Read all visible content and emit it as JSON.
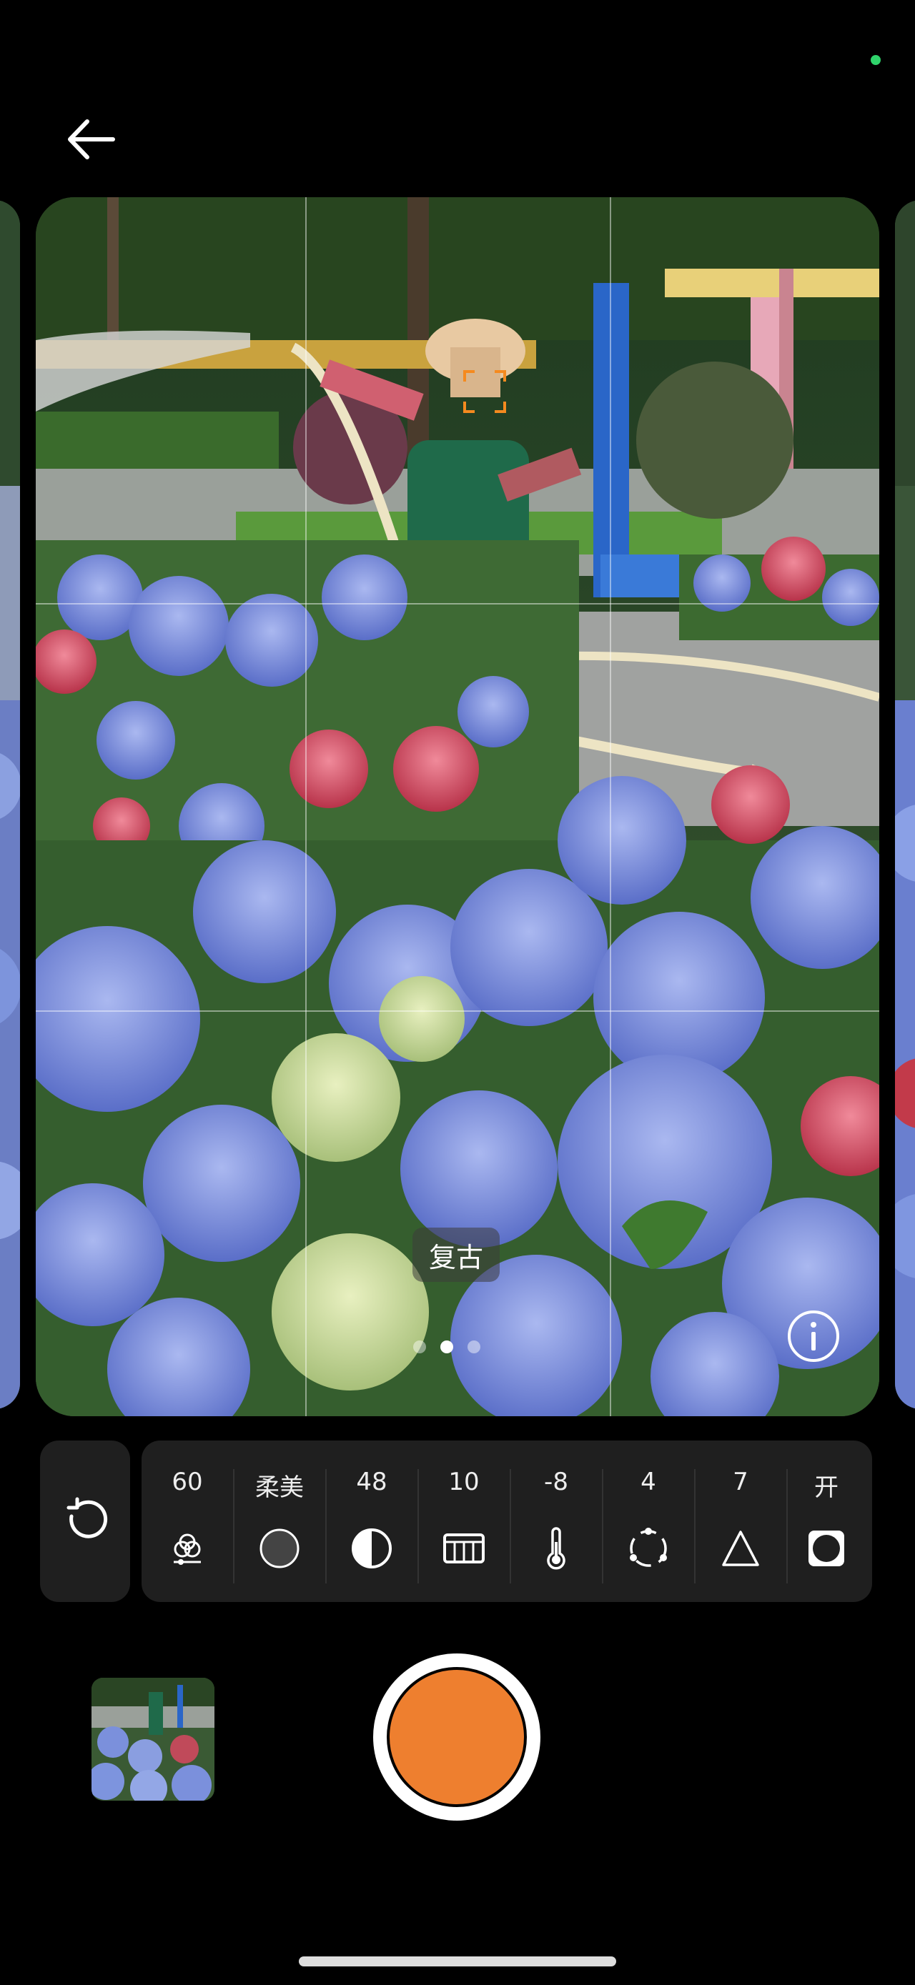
{
  "camera": {
    "film_name": "复古",
    "settings": [
      {
        "id": "filter-strength",
        "value": "60",
        "icon": "tri-circle-icon"
      },
      {
        "id": "style",
        "value": "柔美",
        "icon": "circle-icon"
      },
      {
        "id": "contrast",
        "value": "48",
        "icon": "half-circle-icon"
      },
      {
        "id": "grain",
        "value": "10",
        "icon": "grid-icon"
      },
      {
        "id": "temperature",
        "value": "-8",
        "icon": "thermometer-icon"
      },
      {
        "id": "saturation",
        "value": "4",
        "icon": "dotted-circle-icon"
      },
      {
        "id": "sharpness",
        "value": "7",
        "icon": "triangle-icon"
      },
      {
        "id": "vignette",
        "value": "开",
        "icon": "vignette-icon"
      }
    ],
    "pager": {
      "count": 3,
      "active": 1
    },
    "accent_color": "#ee7f2f",
    "status_dot_color": "#2fd36b"
  }
}
